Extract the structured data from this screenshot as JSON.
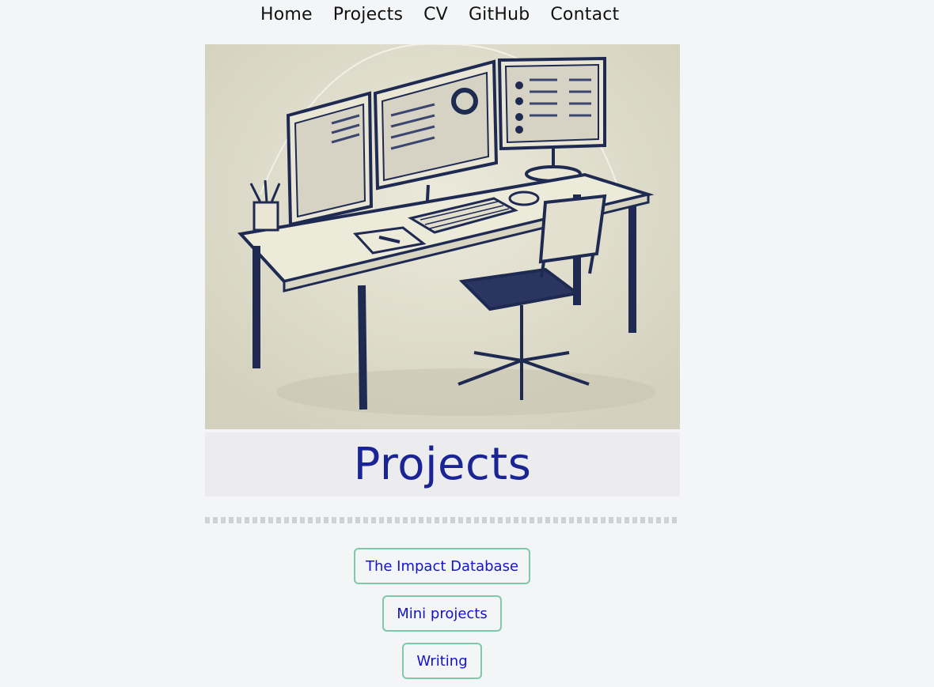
{
  "nav": {
    "items": [
      {
        "label": "Home"
      },
      {
        "label": "Projects"
      },
      {
        "label": "CV"
      },
      {
        "label": "GitHub"
      },
      {
        "label": "Contact"
      }
    ]
  },
  "hero": {
    "image_icon": "desk-workstation-illustration"
  },
  "page": {
    "title": "Projects"
  },
  "links": [
    {
      "label": "The Impact Database"
    },
    {
      "label": "Mini projects"
    },
    {
      "label": "Writing"
    }
  ],
  "colors": {
    "background": "#f3f5f7",
    "title": "#1a2494",
    "link_text": "#1414c8",
    "button_border": "#7ec9a8",
    "title_bg": "#ececef"
  }
}
